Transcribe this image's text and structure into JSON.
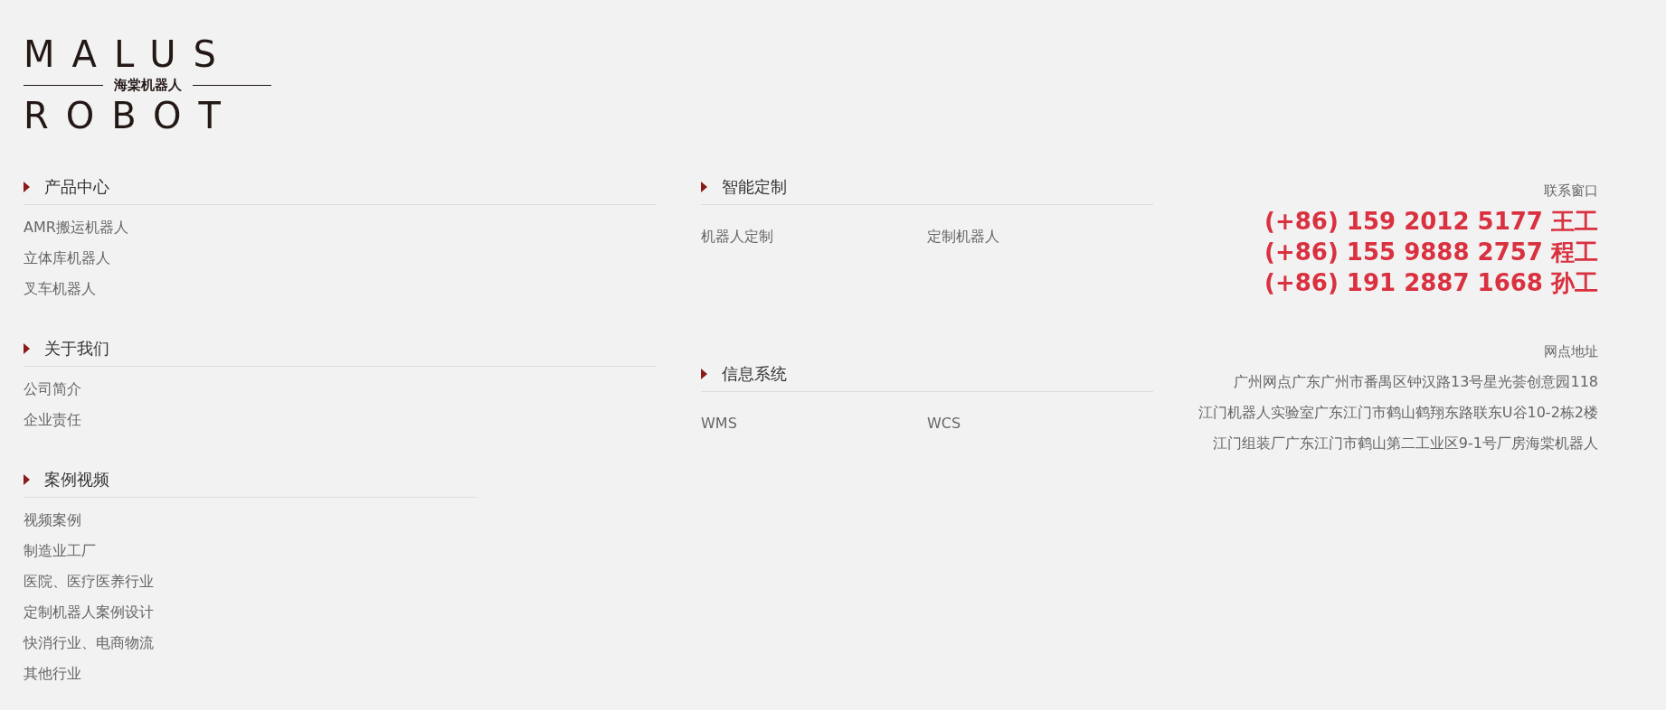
{
  "logo": {
    "top": "MALUS",
    "middle": "海棠机器人",
    "bottom": "ROBOT"
  },
  "columns": [
    {
      "sections": [
        {
          "title": "产品中心",
          "items": [
            "AMR搬运机器人",
            "立体库机器人",
            "叉车机器人"
          ]
        },
        {
          "title": "关于我们",
          "items": [
            "公司简介",
            "企业责任"
          ]
        },
        {
          "title": "案例视频",
          "items": [
            "视频案例",
            "制造业工厂",
            "医院、医疗医养行业",
            "定制机器人案例设计",
            "快消行业、电商物流",
            "其他行业"
          ]
        }
      ]
    },
    {
      "sections": [
        {
          "title": "智能定制",
          "items": [
            "机器人定制",
            "定制机器人"
          ]
        },
        {
          "title": "信息系统",
          "items": [
            "WMS",
            "WCS"
          ]
        }
      ]
    }
  ],
  "contact": {
    "title": "联系窗口",
    "phones": [
      "(+86) 159 2012 5177 王工",
      "(+86) 155 9888 2757 程工",
      "(+86) 191 2887 1668 孙工"
    ]
  },
  "addresses": {
    "title": "网点地址",
    "lines": [
      "广州网点广东广州市番禺区钟汉路13号星光荟创意园118",
      "江门机器人实验室广东江门市鹤山鹤翔东路联东U谷10-2栋2楼",
      "江门组装厂广东江门市鹤山第二工业区9-1号厂房海棠机器人"
    ]
  }
}
